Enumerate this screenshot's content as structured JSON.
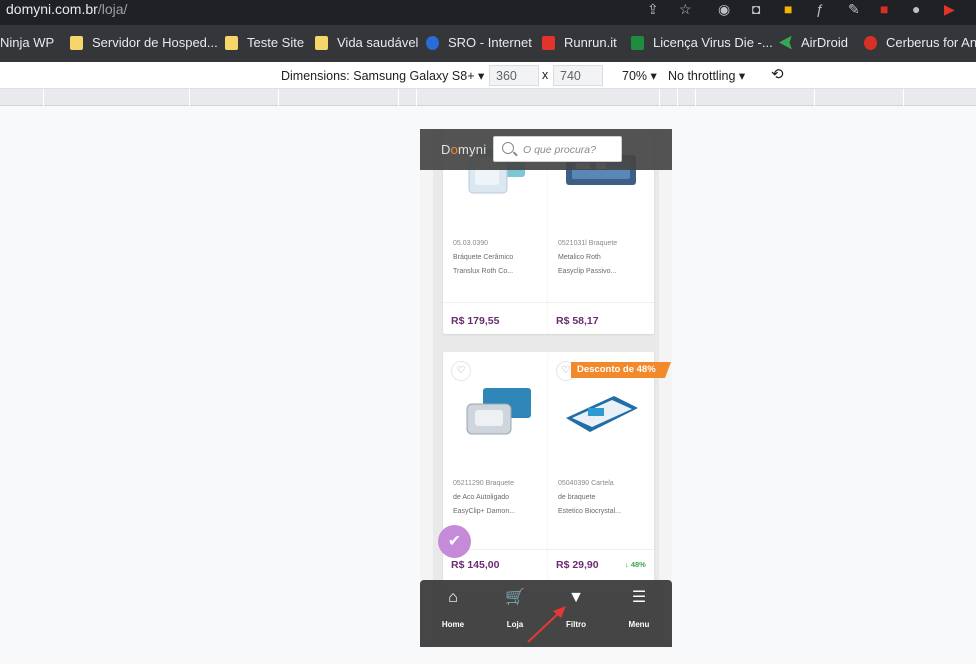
{
  "browser": {
    "url_host": "domyni.com.br",
    "url_path": "/loja/",
    "bookmarks": [
      {
        "label": "Ninja WP",
        "color": "#f4b400"
      },
      {
        "label": "Servidor de Hosped...",
        "color": "#f6d56b"
      },
      {
        "label": "Teste Site",
        "color": "#f6d56b"
      },
      {
        "label": "Vida saudável",
        "color": "#f6d56b"
      },
      {
        "label": "SRO - Internet",
        "color": "#2a6bd6"
      },
      {
        "label": "Runrun.it",
        "color": "#e2342c"
      },
      {
        "label": "Licença Virus Die -...",
        "color": "#1e8e3e"
      },
      {
        "label": "AirDroid",
        "color": "#34a853"
      },
      {
        "label": "Cerberus for And",
        "color": "#d93025"
      }
    ]
  },
  "devtools": {
    "dimensions_label": "Dimensions: Samsung Galaxy S8+",
    "width": "360",
    "times": "x",
    "height": "740",
    "zoom": "70%",
    "throttling": "No throttling"
  },
  "site": {
    "logo": "Domyni",
    "search_placeholder": "O que procura?",
    "products": [
      {
        "sku": "05.03.0390",
        "name_line1": "Bráquete Cerâmico",
        "name_line2": "Translux Roth Co...",
        "name_line3": "",
        "price": "R$ 179,55"
      },
      {
        "sku": "0521031l Braquete",
        "name_line1": "Metalico Roth",
        "name_line2": "Easyclip Passivo...",
        "name_line3": "",
        "price": "R$ 58,17"
      },
      {
        "sku": "05211290 Braquete",
        "name_line1": "de Aco Autoligado",
        "name_line2": "EasyClip+ Damon...",
        "name_line3": "",
        "price": "R$ 145,00"
      },
      {
        "sku": "05040390 Cartela",
        "name_line1": "de braquete",
        "name_line2": "Estetico Biocrystal...",
        "name_line3": "",
        "price": "R$ 29,90"
      }
    ],
    "discount_tag": "Desconto de 48%",
    "discount_pct": "48%",
    "nav": [
      {
        "label": "Home",
        "icon": "home-icon"
      },
      {
        "label": "Loja",
        "icon": "cart-icon"
      },
      {
        "label": "Filtro",
        "icon": "filter-icon"
      },
      {
        "label": "Menu",
        "icon": "menu-icon"
      }
    ]
  }
}
